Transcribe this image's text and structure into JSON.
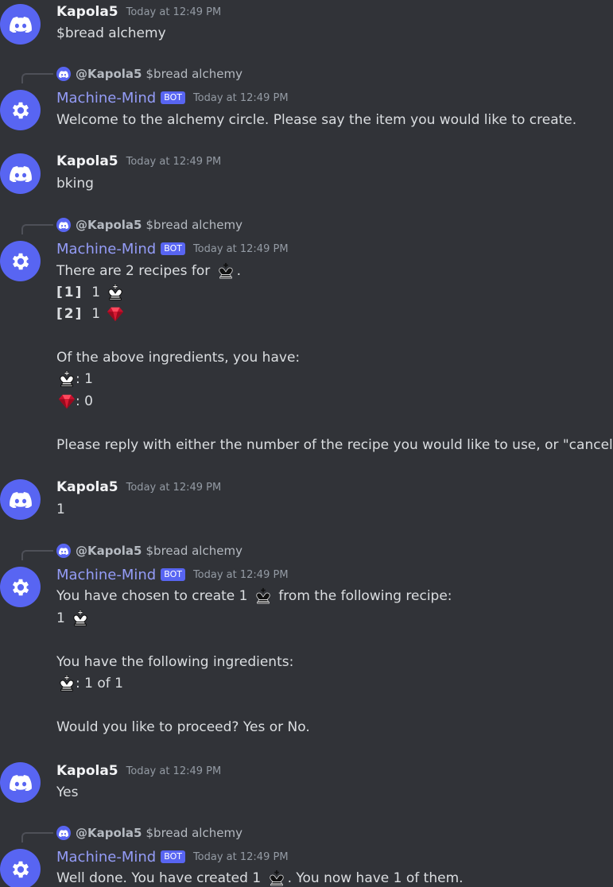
{
  "colors": {
    "background": "#313338",
    "blurple": "#5865f2",
    "bot_name": "#949cf7"
  },
  "messages": [
    {
      "author": "Kapola5",
      "time": "Today at 12:49 PM",
      "text": "$bread alchemy"
    },
    {
      "reply_user": "@Kapola5",
      "reply_text": "$bread alchemy",
      "author": "Machine-Mind",
      "bot_tag": "BOT",
      "time": "Today at 12:49 PM",
      "text": "Welcome to the alchemy circle. Please say the item you would like to create."
    },
    {
      "author": "Kapola5",
      "time": "Today at 12:49 PM",
      "text": "bking"
    },
    {
      "reply_user": "@Kapola5",
      "reply_text": "$bread alchemy",
      "author": "Machine-Mind",
      "bot_tag": "BOT",
      "time": "Today at 12:49 PM",
      "line1_pre": "There are 2 recipes for",
      "line1_post": ".",
      "r1_label": "[1]",
      "r1_qty": "1",
      "r2_label": "[2]",
      "r2_qty": "1",
      "have_intro": "Of the above ingredients, you have:",
      "have_king": ": 1",
      "have_ruby": ": 0",
      "prompt": "Please reply with either the number of the recipe you would like to use, or \"cancel\"."
    },
    {
      "author": "Kapola5",
      "time": "Today at 12:49 PM",
      "text": "1"
    },
    {
      "reply_user": "@Kapola5",
      "reply_text": "$bread alchemy",
      "author": "Machine-Mind",
      "bot_tag": "BOT",
      "time": "Today at 12:49 PM",
      "line1_pre": "You have chosen to create 1",
      "line1_post": "from the following recipe:",
      "line2_qty": "1",
      "ingredients_intro": "You have the following ingredients:",
      "ingredient_count": ": 1 of 1",
      "prompt": "Would you like to proceed? Yes or No."
    },
    {
      "author": "Kapola5",
      "time": "Today at 12:49 PM",
      "text": "Yes"
    },
    {
      "reply_user": "@Kapola5",
      "reply_text": "$bread alchemy",
      "author": "Machine-Mind",
      "bot_tag": "BOT",
      "time": "Today at 12:49 PM",
      "line1_pre": "Well done. You have created 1",
      "line1_post": ". You now have 1 of them."
    }
  ],
  "icons": {
    "user_avatar": "discord-logo-icon",
    "bot_avatar": "gear-icon",
    "white_king": "white-king-icon",
    "black_king": "black-king-icon",
    "ruby": "ruby-gem-icon"
  }
}
